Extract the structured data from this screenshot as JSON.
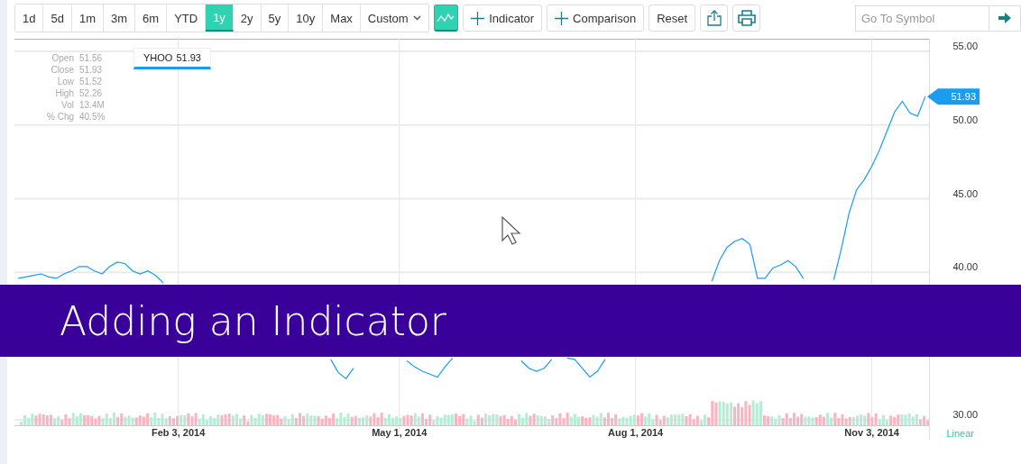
{
  "toolbar": {
    "ranges": [
      {
        "label": "1d",
        "selected": false
      },
      {
        "label": "5d",
        "selected": false
      },
      {
        "label": "1m",
        "selected": false
      },
      {
        "label": "3m",
        "selected": false
      },
      {
        "label": "6m",
        "selected": false
      },
      {
        "label": "YTD",
        "selected": false
      },
      {
        "label": "1y",
        "selected": true
      },
      {
        "label": "2y",
        "selected": false
      },
      {
        "label": "5y",
        "selected": false
      },
      {
        "label": "10y",
        "selected": false
      },
      {
        "label": "Max",
        "selected": false
      }
    ],
    "custom": "Custom",
    "chart_type_selected": true,
    "indicator": "Indicator",
    "comparison": "Comparison",
    "reset": "Reset"
  },
  "symbol_search": {
    "placeholder": "Go To Symbol"
  },
  "quote": {
    "rows": [
      {
        "label": "Open",
        "value": "51.56"
      },
      {
        "label": "Close",
        "value": "51.93"
      },
      {
        "label": "Low",
        "value": "51.52"
      },
      {
        "label": "High",
        "value": "52.26"
      },
      {
        "label": "Vol",
        "value": "13.4M"
      },
      {
        "label": "% Chg",
        "value": "40.5%"
      }
    ],
    "tag_value": "51.93"
  },
  "chart": {
    "price_label": "51.93",
    "scale": "Linear",
    "chart_data": {
      "type": "line",
      "grid": true,
      "ylim": [
        30,
        55.85
      ],
      "categories": [
        null,
        null,
        null,
        null,
        null,
        null,
        null,
        null,
        null,
        null,
        null,
        null,
        null,
        null,
        null,
        null,
        null,
        null,
        null,
        null,
        null,
        "Feb 3, 2014",
        null,
        null,
        null,
        null,
        null,
        null,
        null,
        null,
        null,
        null,
        null,
        null,
        null,
        null,
        null,
        null,
        null,
        null,
        null,
        null,
        null,
        null,
        null,
        null,
        null,
        null,
        null,
        null,
        "May 1, 2014",
        null,
        null,
        null,
        null,
        null,
        null,
        null,
        null,
        null,
        null,
        null,
        null,
        null,
        null,
        null,
        null,
        null,
        null,
        null,
        null,
        null,
        null,
        null,
        null,
        null,
        null,
        null,
        null,
        null,
        null,
        "Aug 1, 2014",
        null,
        null,
        null,
        null,
        null,
        null,
        null,
        null,
        null,
        null,
        null,
        null,
        null,
        null,
        null,
        null,
        null,
        null,
        null,
        null,
        null,
        null,
        null,
        null,
        null,
        null,
        null,
        null,
        null,
        null,
        "Nov 3, 2014",
        null,
        null,
        null,
        null,
        null,
        null,
        null
      ],
      "yticks": [
        {
          "value": 30,
          "label": "30.00"
        },
        {
          "value": 40,
          "label": "40.00"
        },
        {
          "value": 45,
          "label": "45.00"
        },
        {
          "value": 50,
          "label": "50.00"
        },
        {
          "value": 55,
          "label": "55.00"
        }
      ],
      "series": [
        {
          "name": "YHOO",
          "color": "#1a9cf0",
          "values": [
            39.6,
            39.7,
            39.8,
            39.9,
            39.7,
            39.6,
            39.9,
            40.1,
            40.4,
            40.4,
            40.1,
            39.9,
            40.4,
            40.7,
            40.6,
            40.1,
            39.9,
            40.1,
            39.8,
            39.3,
            null,
            null,
            null,
            null,
            null,
            null,
            null,
            null,
            null,
            null,
            null,
            null,
            null,
            null,
            null,
            null,
            null,
            null,
            null,
            null,
            null,
            34.1,
            33.2,
            32.8,
            33.5,
            null,
            null,
            null,
            null,
            null,
            null,
            34.0,
            33.6,
            33.3,
            33.1,
            32.9,
            33.6,
            34.2,
            null,
            null,
            null,
            null,
            null,
            null,
            null,
            null,
            34.0,
            33.5,
            33.3,
            33.5,
            34.1,
            null,
            34.2,
            34.1,
            33.5,
            32.9,
            33.3,
            34.1,
            null,
            null,
            null,
            null,
            null,
            null,
            null,
            null,
            null,
            null,
            null,
            null,
            null,
            39.4,
            40.8,
            41.7,
            42.1,
            42.3,
            41.9,
            39.6,
            39.6,
            40.3,
            40.5,
            40.8,
            40.4,
            39.6,
            null,
            null,
            null,
            39.5,
            41.6,
            44.0,
            45.6,
            46.3,
            47.2,
            48.3,
            49.6,
            50.9,
            51.6,
            50.8,
            50.6,
            51.93
          ]
        }
      ]
    }
  },
  "banner": {
    "title": "Adding an Indicator"
  }
}
